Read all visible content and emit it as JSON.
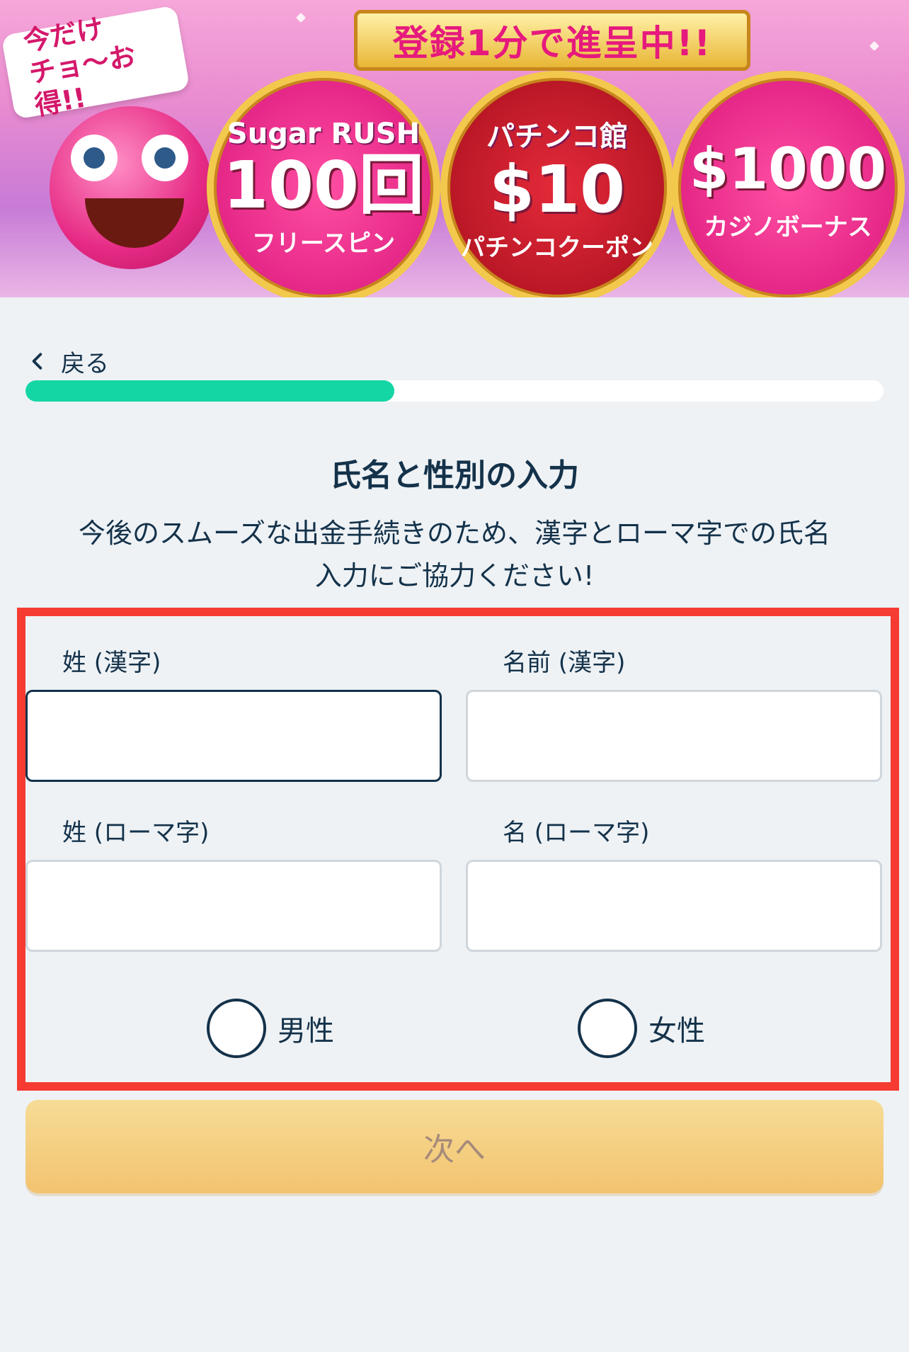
{
  "banner": {
    "limited_text_line1": "今だけ",
    "limited_text_line2": "チョ〜お得!!",
    "ribbon": "登録1分で進呈中!!",
    "offers": [
      {
        "top": "Sugar RUSH",
        "big": "100回",
        "sub": "フリースピン"
      },
      {
        "top": "パチンコ館",
        "big": "$10",
        "sub": "パチンコクーポン"
      },
      {
        "top": "",
        "big": "$1000",
        "sub": "カジノボーナス"
      }
    ]
  },
  "nav": {
    "back_label": "戻る"
  },
  "progress": {
    "fraction": 0.43,
    "color": "#13d6a4"
  },
  "header": {
    "title": "氏名と性別の入力",
    "description_line1": "今後のスムーズな出金手続きのため、漢字とローマ字での氏名",
    "description_line2": "入力にご協力ください!"
  },
  "form": {
    "last_name_kanji_label": "姓 (漢字)",
    "first_name_kanji_label": "名前 (漢字)",
    "last_name_roman_label": "姓 (ローマ字)",
    "first_name_roman_label": "名 (ローマ字)",
    "last_name_kanji_value": "",
    "first_name_kanji_value": "",
    "last_name_roman_value": "",
    "first_name_roman_value": "",
    "gender_male_label": "男性",
    "gender_female_label": "女性"
  },
  "actions": {
    "next_label": "次へ"
  },
  "colors": {
    "highlight_border": "#f53b32",
    "accent_text": "#14324a",
    "button_gradient_top": "#f6dc96",
    "button_gradient_bottom": "#f3c36f"
  }
}
